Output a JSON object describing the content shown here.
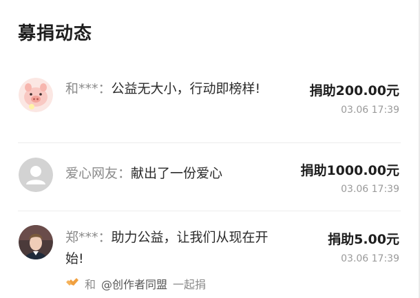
{
  "header": {
    "title": "募捐动态"
  },
  "donations": [
    {
      "name": "和***：",
      "message": "公益无大小，行动即榜样!",
      "amount": "捐助200.00元",
      "time": "03.06 17:39",
      "avatar": "pig-avatar-icon"
    },
    {
      "name": "爱心网友：",
      "message": "献出了一份爱心",
      "amount": "捐助1000.00元",
      "time": "03.06 17:39",
      "avatar": "default-user-avatar-icon"
    },
    {
      "name": "郑***：",
      "message": "助力公益，让我们从现在开始!",
      "amount": "捐助5.00元",
      "time": "03.06 17:39",
      "avatar": "person-photo-avatar",
      "joint": {
        "name": "和",
        "org": "@创作者同盟",
        "action": "一起捐",
        "icon": "handshake-heart-icon"
      }
    }
  ],
  "colors": {
    "accent": "#f0a040",
    "text": "#222222",
    "muted": "#9a9a9a"
  }
}
